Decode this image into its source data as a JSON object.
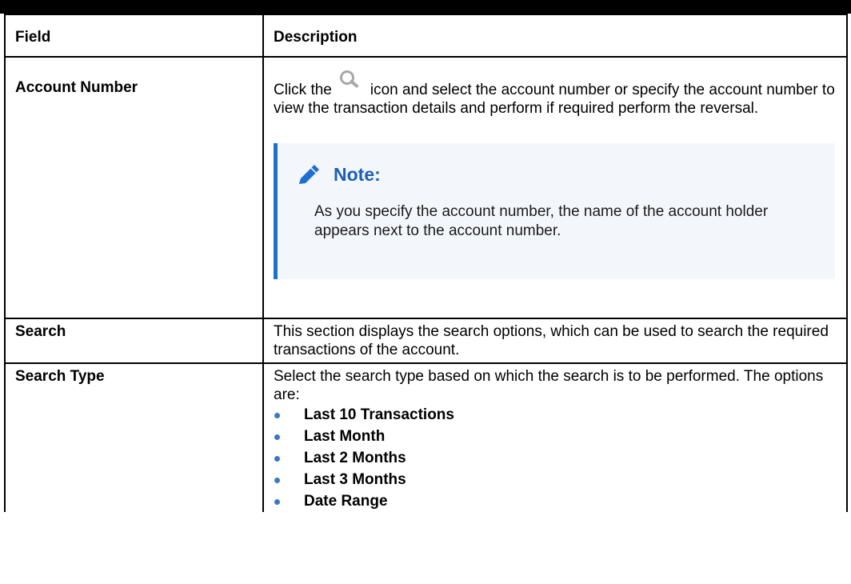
{
  "table": {
    "headers": {
      "field": "Field",
      "description": "Description"
    },
    "rows": {
      "account_number": {
        "field": "Account Number",
        "desc_before_icon": "Click the",
        "icon": "search-icon",
        "desc_after_icon": "icon and select the account number or specify the",
        "desc_rest": "account number to view the transaction details and perform if required perform the reversal.",
        "note": {
          "icon": "pencil-icon",
          "title": "Note:",
          "text": "As you specify the account number, the name of the account holder appears next to the account number."
        }
      },
      "search": {
        "field": "Search",
        "desc": "This section displays the search options, which can be used to search the required transactions of the account."
      },
      "search_type": {
        "field": "Search Type",
        "desc": "Select the search type based on which the search is to be performed. The options are:",
        "options": [
          "Last 10 Transactions",
          "Last Month",
          "Last 2 Months",
          "Last 3 Months",
          "Date Range"
        ]
      }
    }
  },
  "colors": {
    "note_accent": "#1f6fd1",
    "note_title": "#1d5fb5",
    "note_background": "#f3f7fc",
    "bullet": "#3a78c8"
  }
}
